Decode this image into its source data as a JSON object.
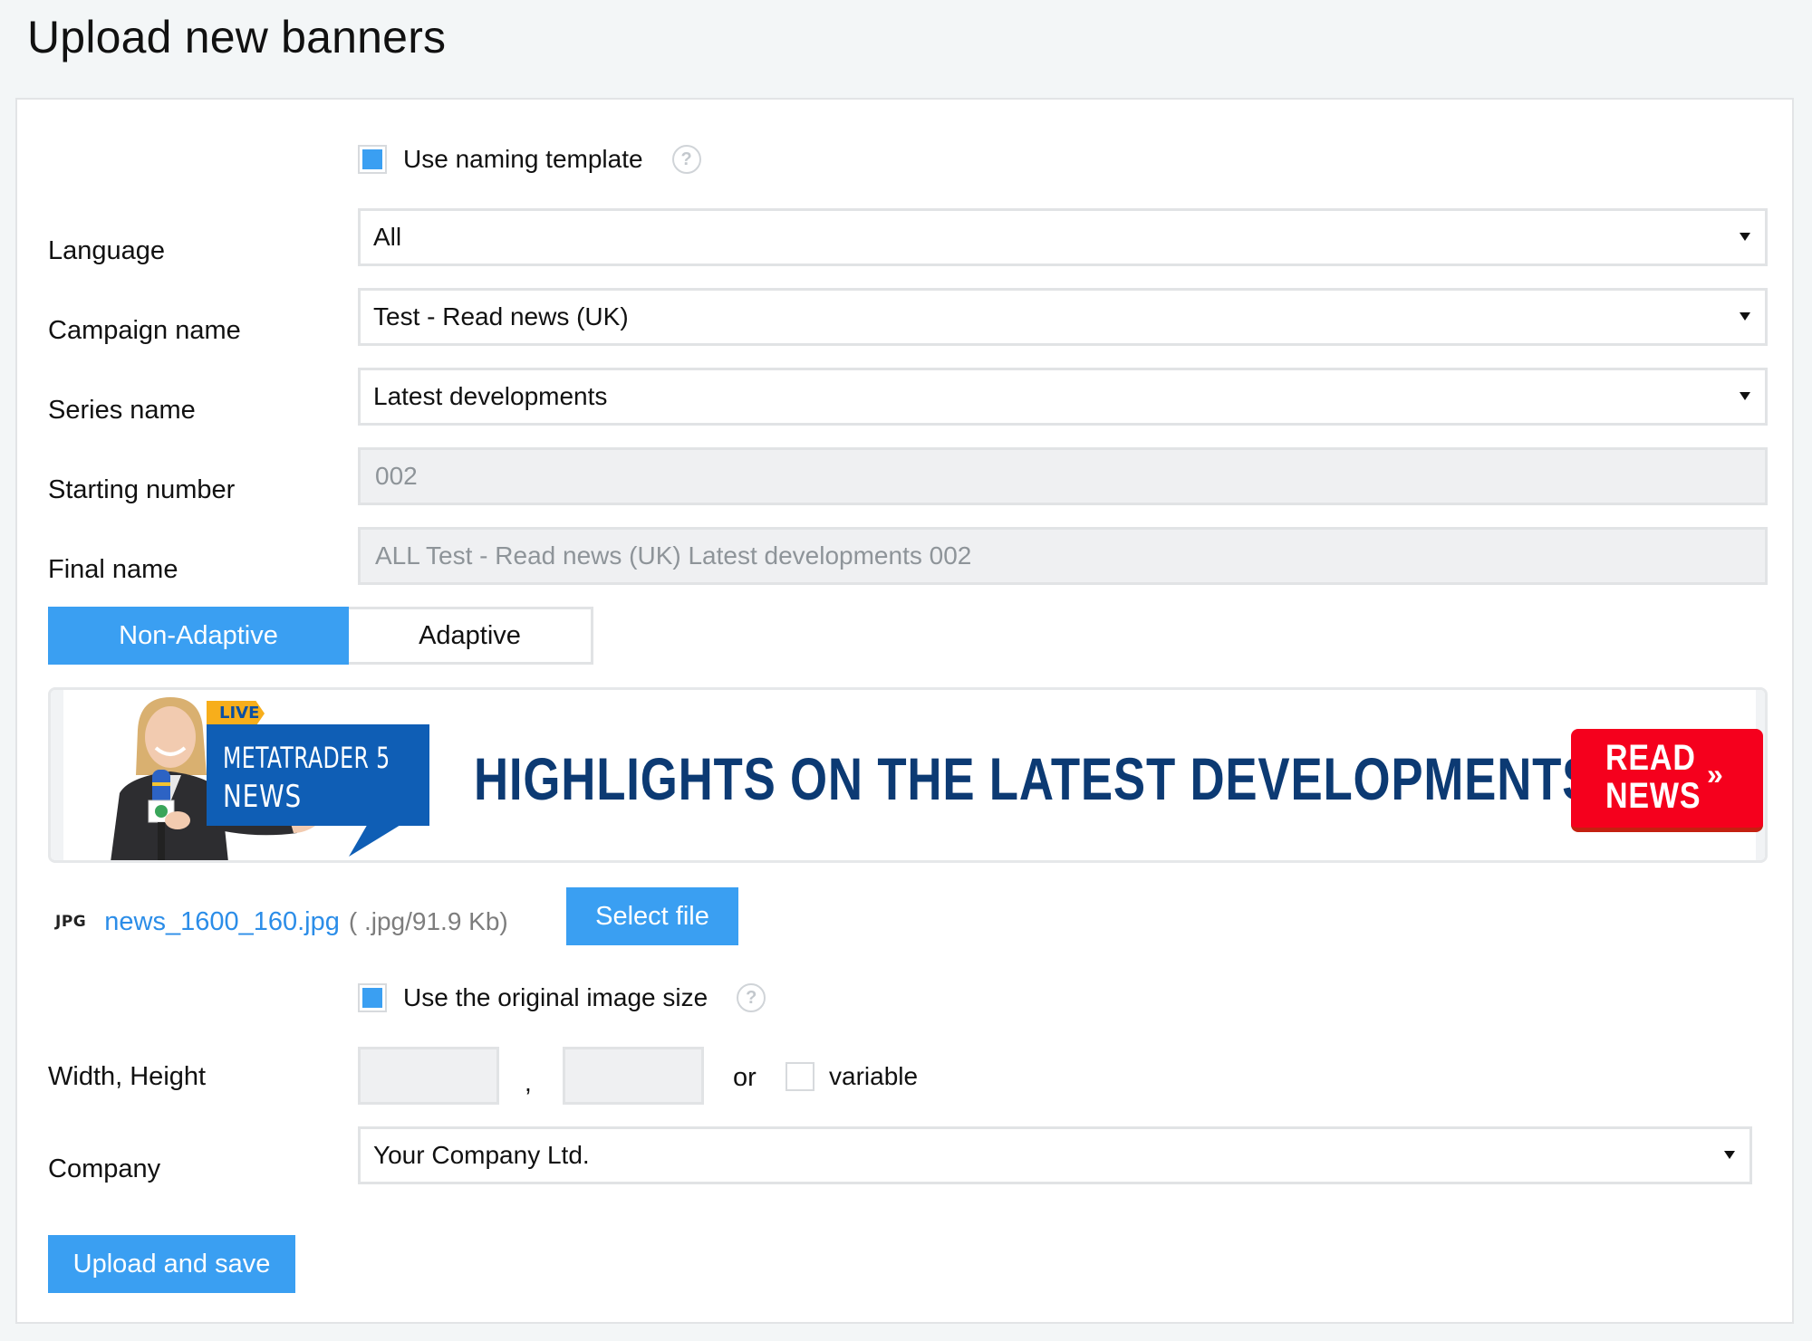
{
  "page": {
    "title": "Upload new banners"
  },
  "naming_template": {
    "label": "Use naming template",
    "checked": true,
    "help_icon": "question-circle-icon"
  },
  "form": {
    "language": {
      "label": "Language",
      "value": "All"
    },
    "campaign_name": {
      "label": "Campaign name",
      "value": "Test - Read news (UK)"
    },
    "series_name": {
      "label": "Series name",
      "value": "Latest developments"
    },
    "starting_number": {
      "label": "Starting number",
      "value": "002"
    },
    "final_name": {
      "label": "Final name",
      "value": "ALL Test - Read news (UK) Latest developments 002"
    }
  },
  "tabs": [
    {
      "label": "Non-Adaptive",
      "active": true
    },
    {
      "label": "Adaptive",
      "active": false
    }
  ],
  "banner_preview": {
    "live_tag": "LIVE",
    "bubble_line1": "METATRADER 5",
    "bubble_line2": "NEWS",
    "headline": "HIGHLIGHTS ON THE LATEST DEVELOPMENTS",
    "cta_line1": "READ",
    "cta_line2": "NEWS",
    "cta_arrow": "»"
  },
  "file": {
    "type_badge": "JPG",
    "name": "news_1600_160.jpg",
    "meta": "( .jpg/91.9 Kb)",
    "select_button": "Select file"
  },
  "original_size": {
    "label": "Use the original image size",
    "checked": true,
    "help_icon": "question-circle-icon"
  },
  "dimensions": {
    "label": "Width, Height",
    "width_value": "",
    "height_value": "",
    "separator": ",",
    "or_text": "or",
    "variable_label": "variable",
    "variable_checked": false
  },
  "company": {
    "label": "Company",
    "value": "Your Company Ltd."
  },
  "actions": {
    "upload_button": "Upload and save"
  },
  "colors": {
    "accent": "#3a9ff2",
    "link": "#2b8de8",
    "banner_blue": "#0f5eb5",
    "banner_red": "#f5001d"
  }
}
